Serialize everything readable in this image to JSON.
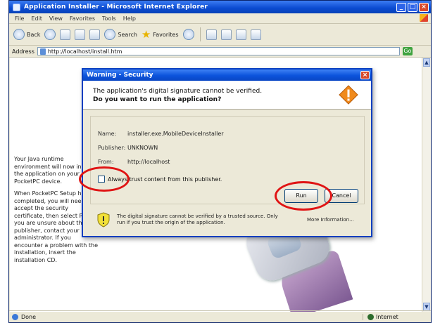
{
  "browser": {
    "window_title": "Application Installer - Microsoft Internet Explorer",
    "menu": [
      "File",
      "Edit",
      "View",
      "Favorites",
      "Tools",
      "Help"
    ],
    "toolbar": {
      "back": "Back",
      "search": "Search",
      "favorites": "Favorites"
    },
    "address_label": "Address",
    "address_value": "http://localhost/install.htm",
    "go_label": "Go",
    "status_left": "Done",
    "status_right": "Internet"
  },
  "page": {
    "paragraphs": [
      "Your Java runtime environment will now install the application on your PocketPC device.",
      "When PocketPC Setup has completed, you will need to accept the security certificate, then select Run. If you are unsure about the publisher, contact your administrator. If you encounter a problem with the installation, insert the installation CD."
    ]
  },
  "dialog": {
    "title": "Warning - Security",
    "message_line1": "The application's digital signature cannot be verified.",
    "message_line2": "Do you want to run the application?",
    "fields": [
      {
        "label": "Name:",
        "value": "installer.exe.MobileDeviceInstaller"
      },
      {
        "label": "Publisher:",
        "value": "UNKNOWN"
      },
      {
        "label": "From:",
        "value": "http://localhost"
      }
    ],
    "always_trust_label": "Always trust content from this publisher.",
    "run_button": "Run",
    "cancel_button": "Cancel",
    "footer_text": "The digital signature cannot be verified by a trusted source. Only run if you trust the origin of the application.",
    "more_info": "More Information..."
  },
  "colors": {
    "titlebar": "#0a4ad0",
    "annotation": "#e01414",
    "warning_icon": "#f08a1c"
  }
}
